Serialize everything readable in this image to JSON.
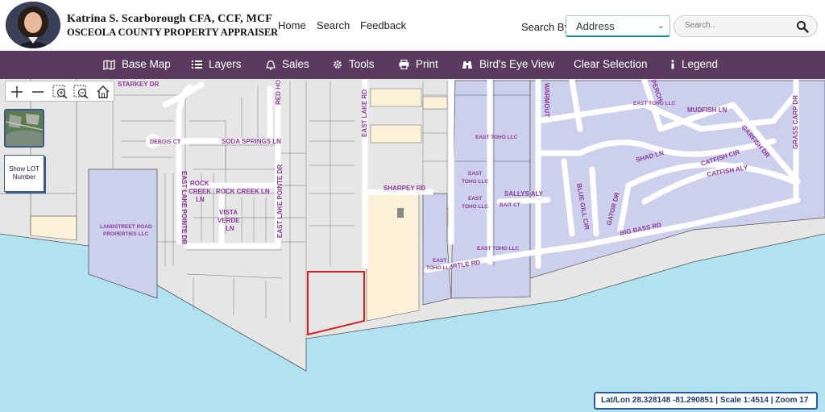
{
  "header": {
    "name_line": "Katrina S. Scarborough CFA, CCF, MCF",
    "office_line": "Osceola County Property Appraiser",
    "links": [
      "Home",
      "Search",
      "Feedback"
    ],
    "search_by_label": "Search By",
    "search_by_value": "Address",
    "search_placeholder": "Search.."
  },
  "toolbar": {
    "items": [
      {
        "label": "Base Map",
        "icon": "map-icon"
      },
      {
        "label": "Layers",
        "icon": "list-icon"
      },
      {
        "label": "Sales",
        "icon": "bell-icon"
      },
      {
        "label": "Tools",
        "icon": "gear-icon"
      },
      {
        "label": "Print",
        "icon": "printer-icon"
      },
      {
        "label": "Bird's Eye View",
        "icon": "binoculars-icon"
      },
      {
        "label": "Clear Selection",
        "icon": ""
      },
      {
        "label": "Legend",
        "icon": "info-icon"
      }
    ]
  },
  "map_controls": {
    "show_lot_number": "Show LOT Number"
  },
  "map": {
    "street_labels": {
      "starkey": "STARKEY DR",
      "debois": "DEBOIS CT",
      "soda": "SODA SPRINGS LN",
      "red_hot": "RED HO",
      "east_lake": "EAST LAKE RD",
      "sharpey": "SHARPEY RD",
      "rock_creek_1": "ROCK",
      "rock_creek_2": "CREEK",
      "rock_creek_3": "LN",
      "rock_creek_ln": "ROCK CREEK LN",
      "vista_1": "VISTA",
      "vista_2": "VERDE",
      "vista_3": "LN",
      "elp_left": "EAST LAKE POINTE DR",
      "elp_right": "EAST LAKE POINTE DR",
      "landstreet_1": "LANDSTREET ROAD",
      "landstreet_2": "PROPERTIES LLC",
      "toho_1": "EAST TOHO LLC",
      "toho_2a": "EAST",
      "toho_2b": "TOHO LLC",
      "toho_3a": "EAST",
      "toho_3b": "TOHO LLC",
      "toho_4": "EAST TOHO LLC",
      "toho_5": "EAST TOHO LLC",
      "toho_6a": "EAST",
      "toho_6b": "TOHO LLC",
      "myrtle": "IRTLE RD",
      "sallys": "SALLYS ALY",
      "bait": "BAIT CT",
      "warmouth": "WARMOUT",
      "perch": "PERCH",
      "mudfish": "MUDFISH LN",
      "garfish": "GARFISH DR",
      "grass_carp": "GRASS CARP DR",
      "shad": "SHAD LN",
      "catfish_cir": "CATFISH CIR",
      "catfish_aly": "CATFISH ALY",
      "blue_gill": "BLUE GILL CIR",
      "gator": "GATOR DR",
      "big_bass": "BIG BASS RD"
    }
  },
  "status": {
    "coords": "Lat/Lon 28.328148 -81.290851 | Scale 1:4514 | Zoom 17"
  },
  "colors": {
    "navbar": "#5a3b5d",
    "water": "#b0e2f2",
    "parcel": "#e6e6e6",
    "owner_parcel": "#ccd0ec",
    "selected_outline": "#d22222",
    "label": "#8c3a9a"
  }
}
